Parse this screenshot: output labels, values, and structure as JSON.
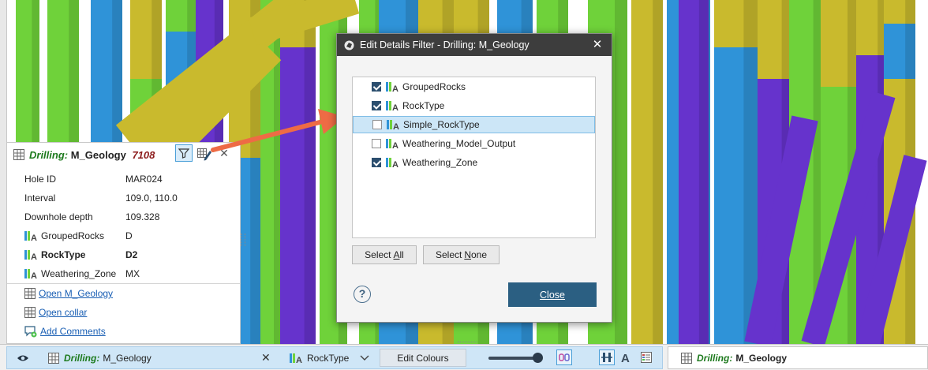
{
  "colors": {
    "rock_green": "#6fd23a",
    "rock_blue": "#2f93d8",
    "rock_purple": "#6633cc",
    "rock_yellow": "#c9ba2d",
    "accent_arrow": "#ee6b45",
    "dialog_title_bg": "#3d3d3d",
    "primary_button": "#2b5f82"
  },
  "info_panel": {
    "title_kind": "Drilling:",
    "title_object": "M_Geology",
    "title_count": "7108",
    "rows": [
      {
        "key": "Hole ID",
        "value": "MAR024",
        "icon": ""
      },
      {
        "key": "Interval",
        "value": "109.0, 110.0",
        "icon": ""
      },
      {
        "key": "Downhole depth",
        "value": "109.328",
        "icon": ""
      },
      {
        "key": "GroupedRocks",
        "value": "D",
        "icon": "category-column-icon"
      },
      {
        "key": "RockType",
        "value": "D2",
        "icon": "category-column-icon"
      },
      {
        "key": "Weathering_Zone",
        "value": "MX",
        "icon": "category-column-icon"
      }
    ],
    "links": [
      {
        "label": "Open M_Geology",
        "icon": "table-icon"
      },
      {
        "label": "Open collar",
        "icon": "table-icon"
      },
      {
        "label": "Add Comments",
        "icon": "comment-add-icon"
      }
    ]
  },
  "dialog": {
    "title": "Edit Details Filter - Drilling: M_Geology",
    "items": [
      {
        "label": "GroupedRocks",
        "checked": true,
        "selected": false
      },
      {
        "label": "RockType",
        "checked": true,
        "selected": false
      },
      {
        "label": "Simple_RockType",
        "checked": false,
        "selected": true
      },
      {
        "label": "Weathering_Model_Output",
        "checked": false,
        "selected": false
      },
      {
        "label": "Weathering_Zone",
        "checked": true,
        "selected": false
      }
    ],
    "select_all": "Select All",
    "select_none": "Select None",
    "help": "?",
    "close": "Close"
  },
  "bottom_bar": {
    "left_kind": "Drilling:",
    "left_object": "M_Geology",
    "colour_by": "RockType",
    "edit_colours": "Edit Colours",
    "opacity": 1.0,
    "right_kind": "Drilling:",
    "right_object": "M_Geology"
  }
}
